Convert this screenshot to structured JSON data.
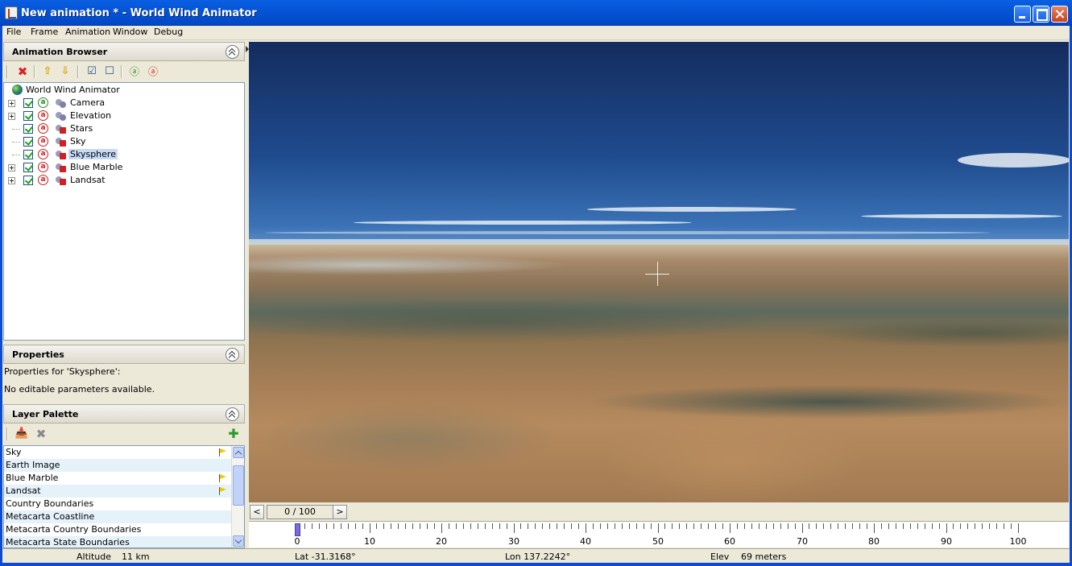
{
  "window": {
    "title": "New animation * - World Wind Animator"
  },
  "menu": [
    "File",
    "Frame",
    "Animation",
    "Window",
    "Debug"
  ],
  "animation_browser": {
    "title": "Animation Browser",
    "toolbar_icons": [
      "delete-icon",
      "move-up-icon",
      "move-down-icon",
      "check-all-icon",
      "uncheck-all-icon",
      "animate-enable-icon",
      "animate-disable-icon"
    ],
    "root_label": "World Wind Animator",
    "items": [
      {
        "label": "Camera",
        "expandable": true,
        "checked": true,
        "anim": "green",
        "icon": "camera-node-icon"
      },
      {
        "label": "Elevation",
        "expandable": true,
        "checked": true,
        "anim": "red",
        "icon": "elevation-node-icon"
      },
      {
        "label": "Stars",
        "expandable": false,
        "checked": true,
        "anim": "red",
        "icon": "layer-node-icon"
      },
      {
        "label": "Sky",
        "expandable": false,
        "checked": true,
        "anim": "red",
        "icon": "layer-node-icon"
      },
      {
        "label": "Skysphere",
        "expandable": false,
        "checked": true,
        "anim": "red",
        "icon": "layer-node-icon",
        "selected": true
      },
      {
        "label": "Blue Marble",
        "expandable": true,
        "checked": true,
        "anim": "red",
        "icon": "layer-node-icon"
      },
      {
        "label": "Landsat",
        "expandable": true,
        "checked": true,
        "anim": "red",
        "icon": "layer-node-icon"
      }
    ]
  },
  "properties": {
    "title": "Properties",
    "header_text": "Properties for 'Skysphere':",
    "body_text": "No editable parameters available."
  },
  "layer_palette": {
    "title": "Layer Palette",
    "toolbar_icons": [
      "import-layer-icon",
      "remove-layer-icon",
      "add-layer-icon"
    ],
    "layers": [
      {
        "label": "Sky",
        "flag": true
      },
      {
        "label": "Earth Image",
        "flag": false
      },
      {
        "label": "Blue Marble",
        "flag": true
      },
      {
        "label": "Landsat",
        "flag": true
      },
      {
        "label": "Country Boundaries",
        "flag": false
      },
      {
        "label": "Metacarta Coastline",
        "flag": false
      },
      {
        "label": "Metacarta Country Boundaries",
        "flag": false
      },
      {
        "label": "Metacarta State Boundaries",
        "flag": false
      }
    ]
  },
  "frame_nav": {
    "prev": "<",
    "next": ">",
    "counter": "0 / 100"
  },
  "timeline": {
    "labels": [
      "0",
      "10",
      "20",
      "30",
      "40",
      "50",
      "60",
      "70",
      "80",
      "90",
      "100"
    ],
    "min": 0,
    "max": 100,
    "current_frame": 0
  },
  "status": {
    "altitude_label": "Altitude",
    "altitude_value": "11 km",
    "lat": "Lat -31.3168°",
    "lon": "Lon 137.2242°",
    "elev_label": "Elev",
    "elev_value": "69 meters"
  },
  "colors": {
    "titlebar": "#0453d4",
    "selection": "#c6d9f7",
    "anim_enabled": "#2c8a2c",
    "anim_disabled": "#d02020",
    "playhead": "#7a6cd6"
  }
}
